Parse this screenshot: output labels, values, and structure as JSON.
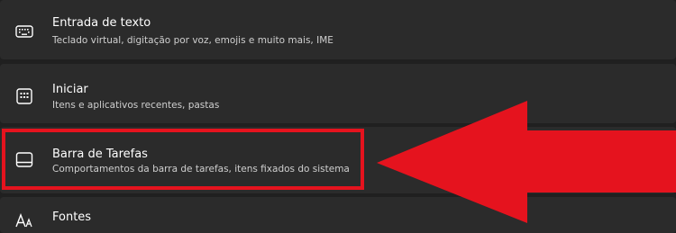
{
  "settings_items": [
    {
      "title": "Entrada de texto",
      "description": "Teclado virtual, digitação por voz, emojis e muito mais, IME",
      "icon": "keyboard-icon"
    },
    {
      "title": "Iniciar",
      "description": "Itens e aplicativos recentes, pastas",
      "icon": "start-menu-icon"
    },
    {
      "title": "Barra de Tarefas",
      "description": "Comportamentos da barra de tarefas, itens fixados do sistema",
      "icon": "taskbar-icon"
    },
    {
      "title": "Fontes",
      "icon": "fonts-icon"
    }
  ],
  "annotation": {
    "color": "#e5131e",
    "type": "red-arrow-and-box"
  }
}
